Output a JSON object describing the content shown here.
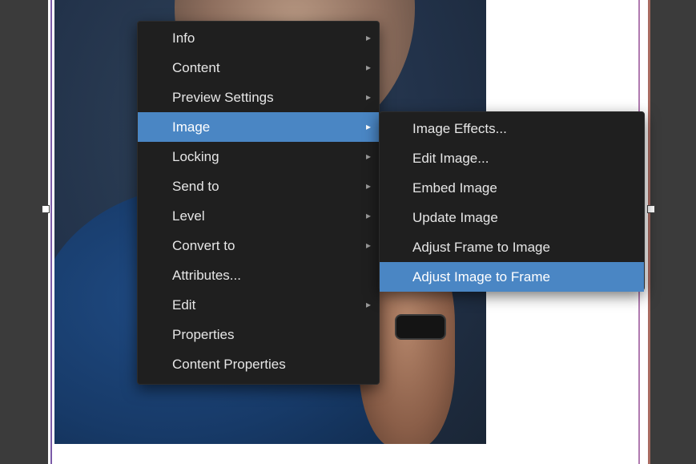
{
  "context_menu": {
    "items": [
      {
        "label": "Info",
        "has_submenu": true
      },
      {
        "label": "Content",
        "has_submenu": true
      },
      {
        "label": "Preview Settings",
        "has_submenu": true
      },
      {
        "label": "Image",
        "has_submenu": true,
        "active": true
      },
      {
        "label": "Locking",
        "has_submenu": true
      },
      {
        "label": "Send to",
        "has_submenu": true
      },
      {
        "label": "Level",
        "has_submenu": true
      },
      {
        "label": "Convert to",
        "has_submenu": true
      },
      {
        "label": "Attributes...",
        "has_submenu": false
      },
      {
        "label": "Edit",
        "has_submenu": true
      },
      {
        "label": "Properties",
        "has_submenu": false
      },
      {
        "label": "Content Properties",
        "has_submenu": false
      }
    ],
    "submenu_glyph": "▸"
  },
  "image_submenu": {
    "items": [
      {
        "label": "Image Effects..."
      },
      {
        "label": "Edit Image..."
      },
      {
        "label": "Embed Image"
      },
      {
        "label": "Update Image"
      },
      {
        "label": "Adjust Frame to Image"
      },
      {
        "label": "Adjust Image to Frame",
        "active": true
      }
    ]
  },
  "colors": {
    "highlight": "#4a86c4",
    "menu_bg": "#1f1f1f",
    "menu_text": "#e6e6e6"
  }
}
